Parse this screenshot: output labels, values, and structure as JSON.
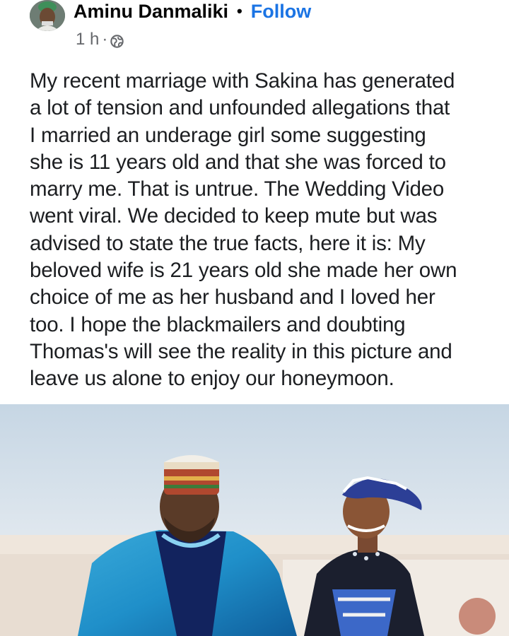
{
  "post": {
    "author_name": "Aminu Danmaliki",
    "separator": "•",
    "follow_label": "Follow",
    "timestamp": "1 h",
    "meta_separator": "·",
    "audience_icon": "globe-icon",
    "text_lines": [
      "My recent marriage with Sakina has generated",
      "a lot of tension and unfounded allegations that",
      "I married an underage girl some suggesting",
      "she is 11 years old and that she was forced to",
      "marry me. That is untrue. The Wedding Video",
      "went viral. We decided to keep mute but was",
      "advised to state the true facts, here it is: My",
      "beloved wife is 21 years old she made her own",
      "choice of me as her husband and I loved her",
      "too. I hope the blackmailers and doubting",
      "Thomas's will see the reality in this picture and",
      "leave us alone to enjoy our honeymoon."
    ]
  },
  "colors": {
    "link_blue": "#1b74e4",
    "meta_gray": "#65676b",
    "text_dark": "#1c1e21"
  }
}
